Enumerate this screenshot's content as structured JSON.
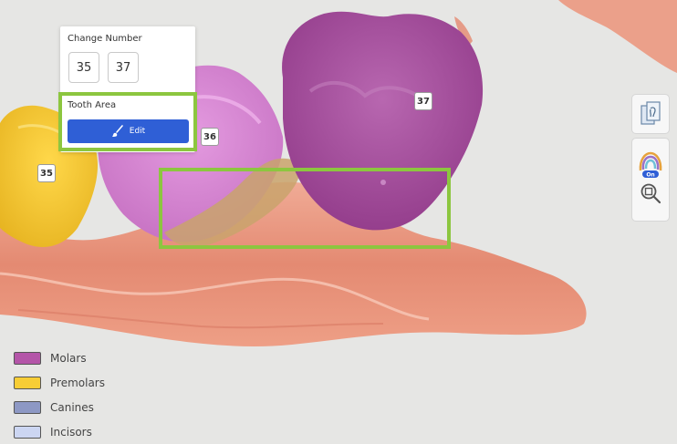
{
  "panel": {
    "change_number_label": "Change Number",
    "number_a": "35",
    "number_b": "37",
    "tooth_area_label": "Tooth Area",
    "edit_label": "Edit"
  },
  "tooth_labels": {
    "t35": "35",
    "t36": "36",
    "t37": "37"
  },
  "toolbar": {
    "buttons": [
      "layers-icon",
      "arch-toggle-icon",
      "zoom-fit-icon"
    ],
    "toggle_text": "On"
  },
  "legend": {
    "items": [
      {
        "label": "Molars",
        "color": "#b455a8"
      },
      {
        "label": "Premolars",
        "color": "#f7cd35"
      },
      {
        "label": "Canines",
        "color": "#8d98c4"
      },
      {
        "label": "Incisors",
        "color": "#ccd6f2"
      }
    ]
  },
  "colors": {
    "accent": "#2f5fd6",
    "highlight": "#8cc63f",
    "molar": "#a94ea0",
    "premolar": "#f2c330",
    "gum": "#e8957f"
  }
}
